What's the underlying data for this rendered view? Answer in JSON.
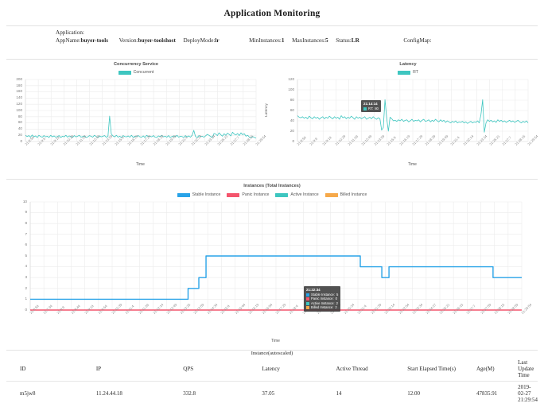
{
  "header": {
    "title": "Application Monitoring"
  },
  "application": {
    "section_label": "Application:",
    "fields": [
      {
        "key": "AppName:",
        "value": "buyer-tools"
      },
      {
        "key": "Version:",
        "value": "buyer-toolshost"
      },
      {
        "key": "DeployMode:",
        "value": "lr"
      },
      {
        "key": "MinInstances:",
        "value": "1"
      },
      {
        "key": "MaxInstances:",
        "value": "5"
      },
      {
        "key": "Status:",
        "value": "LR"
      },
      {
        "key": "ConfigMap:",
        "value": ""
      }
    ],
    "appname_key": "AppName:",
    "appname_value": "buyer-tools",
    "version_key": "Version:",
    "version_value": "buyer-toolshost",
    "deploymode_key": "DeployMode:",
    "deploymode_value": "lr",
    "mininstances_key": "MinInstances:",
    "mininstances_value": "1",
    "maxinstances_key": "MaxInstances:",
    "maxinstances_value": "5",
    "status_key": "Status:",
    "status_value": "LR",
    "configmap_key": "ConfigMap:",
    "configmap_value": ""
  },
  "colors": {
    "teal": "#3ec6c0",
    "blue": "#29a3e8",
    "pink": "#f4556d",
    "orange": "#f6a94a",
    "grid": "#ebebeb",
    "axis": "#d6d6d6",
    "tooltip_bg": "#3a3a3a"
  },
  "chart_data": [
    {
      "id": "concurrency",
      "type": "line",
      "title": "Concurrency Service",
      "xlabel": "Time",
      "ylabel": "Concurrent",
      "ylim": [
        0,
        200
      ],
      "yticks": [
        0,
        20,
        40,
        60,
        80,
        100,
        120,
        140,
        160,
        180,
        200
      ],
      "grid": true,
      "legend_position": "top-center",
      "legend": [
        {
          "name": "Concurrent",
          "color": "#3ec6c0"
        }
      ],
      "xticks": [
        "21:8:59",
        "21:9:9",
        "21:9:19",
        "21:10:29",
        "21:11:39",
        "21:12:49",
        "21:13:59",
        "21:15:9",
        "21:16:19",
        "21:17:29",
        "21:18:39",
        "21:19:49",
        "21:21:4",
        "21:22:14",
        "21:23:34",
        "21:25:21",
        "21:27:7",
        "21:28:15",
        "21:29:54"
      ],
      "series": [
        {
          "name": "Concurrent",
          "color": "#3ec6c0",
          "values": [
            20,
            16,
            19,
            14,
            21,
            15,
            18,
            13,
            20,
            16,
            14,
            19,
            15,
            17,
            13,
            20,
            15,
            18,
            14,
            16,
            19,
            13,
            17,
            15,
            20,
            14,
            18,
            16,
            13,
            19,
            15,
            17,
            20,
            14,
            16,
            18,
            13,
            15,
            19,
            17,
            14,
            20,
            16,
            13,
            18,
            15,
            17,
            19,
            14,
            16,
            82,
            24,
            18,
            15,
            20,
            14,
            17,
            13,
            19,
            16,
            15,
            18,
            14,
            20,
            13,
            17,
            16,
            19,
            15,
            14,
            18,
            13,
            20,
            16,
            17,
            15,
            19,
            14,
            13,
            18,
            16,
            20,
            15,
            17,
            14,
            19,
            13,
            16,
            18,
            15,
            20,
            14,
            17,
            16,
            13,
            19,
            15,
            18,
            14,
            20,
            36,
            16,
            13,
            19,
            15,
            17,
            14,
            18,
            23,
            20,
            16,
            13,
            26,
            24,
            19,
            28,
            22,
            17,
            25,
            20,
            27,
            23,
            18,
            30,
            24,
            21,
            26,
            19,
            28,
            22,
            25,
            17,
            20,
            14,
            12,
            16,
            13,
            11
          ]
        }
      ]
    },
    {
      "id": "latency",
      "type": "line",
      "title": "Latency",
      "xlabel": "Time",
      "ylabel": "Latency",
      "ylim": [
        0,
        120
      ],
      "yticks": [
        0,
        20,
        40,
        60,
        80,
        100,
        120
      ],
      "grid": true,
      "legend_position": "top-center",
      "legend": [
        {
          "name": "RT",
          "color": "#3ec6c0"
        }
      ],
      "xticks": [
        "21:8:59",
        "21:9:9",
        "21:9:19",
        "21:10:29",
        "21:11:39",
        "21:12:49",
        "21:13:59",
        "21:15:9",
        "21:16:19",
        "21:17:29",
        "21:18:39",
        "21:19:49",
        "21:21:4",
        "21:22:14",
        "21:23:34",
        "21:25:21",
        "21:27:7",
        "21:28:15",
        "21:29:54"
      ],
      "series": [
        {
          "name": "RT",
          "color": "#3ec6c0",
          "values": [
            50,
            47,
            46,
            48,
            45,
            47,
            44,
            49,
            46,
            44,
            48,
            45,
            47,
            43,
            46,
            48,
            44,
            47,
            45,
            49,
            46,
            44,
            48,
            45,
            47,
            43,
            50,
            46,
            48,
            44,
            47,
            45,
            49,
            46,
            43,
            48,
            45,
            47,
            44,
            46,
            48,
            43,
            45,
            47,
            44,
            48,
            45,
            43,
            46,
            44,
            22,
            27,
            81,
            45,
            20,
            47,
            44,
            40,
            41,
            39,
            42,
            40,
            43,
            39,
            41,
            42,
            38,
            40,
            43,
            39,
            41,
            40,
            42,
            38,
            41,
            43,
            39,
            40,
            42,
            38,
            41,
            39,
            43,
            40,
            38,
            42,
            39,
            41,
            37,
            40,
            38,
            36,
            39,
            37,
            40,
            36,
            38,
            37,
            39,
            36,
            38,
            35,
            37,
            39,
            36,
            38,
            37,
            40,
            36,
            52,
            81,
            18,
            36,
            42,
            39,
            41,
            38,
            40,
            37,
            42,
            39,
            41,
            38,
            40,
            37,
            39,
            41,
            38,
            40,
            37,
            39,
            41,
            38,
            36,
            39,
            37,
            40,
            36
          ]
        }
      ],
      "tooltip": {
        "time": "21:14:14",
        "rows": [
          {
            "name": "RT:",
            "value": "80",
            "color": "#3ec6c0"
          }
        ]
      }
    },
    {
      "id": "instances",
      "type": "line",
      "title": "Instances (Total Instances)",
      "xlabel": "Time",
      "ylabel": "Instances",
      "ylim": [
        0,
        10
      ],
      "yticks": [
        0,
        1,
        2,
        3,
        4,
        5,
        6,
        7,
        8,
        9,
        10
      ],
      "grid": true,
      "legend_position": "top-center",
      "legend": [
        {
          "name": "Stable Instance",
          "color": "#29a3e8"
        },
        {
          "name": "Panic Instance",
          "color": "#f4556d"
        },
        {
          "name": "Active Instance",
          "color": "#3ec6c0"
        },
        {
          "name": "Billed Instance",
          "color": "#f6a94a"
        }
      ],
      "xticks": [
        "21:6:59",
        "21:7:34",
        "21:8:9",
        "21:8:44",
        "21:9:19",
        "21:9:54",
        "21:10:39",
        "21:11:4",
        "21:11:39",
        "21:12:14",
        "21:12:49",
        "21:13:25",
        "21:13:59",
        "21:14:34",
        "21:15:9",
        "21:15:44",
        "21:16:19",
        "21:16:54",
        "21:17:29",
        "21:18:4",
        "21:18:39",
        "21:19:14",
        "21:19:49",
        "21:20:24",
        "21:21:4",
        "21:21:39",
        "21:22:14",
        "21:22:54",
        "21:23:34",
        "21:24:27",
        "21:25:21",
        "21:26:15",
        "21:27:7",
        "21:27:59",
        "21:28:15",
        "21:28:59",
        "21:29:54"
      ],
      "series": [
        {
          "name": "Stable Instance",
          "color": "#29a3e8",
          "values": [
            1,
            1,
            1,
            1,
            1,
            1,
            1,
            1,
            1,
            1,
            1,
            1,
            1,
            1,
            1,
            1,
            1,
            1,
            1,
            1,
            1,
            1,
            1,
            1,
            1,
            1,
            1,
            1,
            1,
            1,
            1,
            1,
            1,
            1,
            1,
            1,
            1,
            1,
            1,
            1,
            1,
            1,
            1,
            1,
            2,
            2,
            2,
            3,
            3,
            5,
            5,
            5,
            5,
            5,
            5,
            5,
            5,
            5,
            5,
            5,
            5,
            5,
            5,
            5,
            5,
            5,
            5,
            5,
            5,
            5,
            5,
            5,
            5,
            5,
            5,
            5,
            5,
            5,
            5,
            5,
            5,
            5,
            5,
            5,
            5,
            5,
            5,
            5,
            5,
            5,
            5,
            5,
            4,
            4,
            4,
            4,
            4,
            4,
            3,
            3,
            4,
            4,
            4,
            4,
            4,
            4,
            4,
            4,
            4,
            4,
            4,
            4,
            4,
            4,
            4,
            4,
            4,
            4,
            4,
            4,
            4,
            4,
            4,
            4,
            4,
            4,
            4,
            4,
            4,
            3,
            3,
            3,
            3,
            3,
            3,
            3,
            3,
            3
          ]
        },
        {
          "name": "Panic Instance",
          "color": "#f4556d",
          "values": [
            0,
            0,
            0,
            0,
            0,
            0,
            0,
            0,
            0,
            0,
            0,
            0,
            0,
            0,
            0,
            0,
            0,
            0,
            0,
            0,
            0,
            0,
            0,
            0,
            0,
            0,
            0,
            0,
            0,
            0,
            0,
            0,
            0,
            0,
            0,
            0,
            0,
            0,
            0,
            0,
            0,
            0,
            0,
            0,
            0,
            0,
            0,
            0,
            0,
            0,
            0,
            0,
            0,
            0,
            0,
            0,
            0,
            0,
            0,
            0,
            0,
            0,
            0,
            0,
            0,
            0,
            0,
            0,
            0,
            0,
            0,
            0,
            0,
            0,
            0,
            0,
            0,
            0,
            0,
            0,
            0,
            0,
            0,
            0,
            0,
            0,
            0,
            0,
            0,
            0,
            0,
            0,
            0,
            0,
            0,
            0,
            0,
            0,
            0,
            0,
            0,
            0,
            0,
            0,
            0,
            0,
            0,
            0,
            0,
            0,
            0,
            0,
            0,
            0,
            0,
            0,
            0,
            0,
            0,
            0,
            0,
            0,
            0,
            0,
            0,
            0,
            0,
            0,
            0,
            0,
            0,
            0,
            0,
            0,
            0,
            0,
            0,
            0
          ]
        }
      ],
      "tooltip": {
        "time": "21:22:34",
        "rows": [
          {
            "name": "Stable Instance:",
            "value": "5",
            "color": "#29a3e8"
          },
          {
            "name": "Panic Instance:",
            "value": "0",
            "color": "#f4556d"
          },
          {
            "name": "Active Instance:",
            "value": "2",
            "color": "#3ec6c0"
          },
          {
            "name": "Billed Instance:",
            "value": "2",
            "color": "#f6a94a"
          }
        ]
      }
    }
  ],
  "instance_table": {
    "title": "Instance(autoscaled)",
    "columns": [
      "ID",
      "IP",
      "QPS",
      "Latency",
      "Active Thread",
      "Start Elapsed Time(s)",
      "Age(M)",
      "Last Update Time"
    ],
    "rows": [
      {
        "id": "m5jw8",
        "ip": "11.24.44.18",
        "qps": "332.8",
        "latency": "37.05",
        "active_thread": "14",
        "start_elapsed": "12.00",
        "age": "47835.91",
        "last_update": "2019-02-27 21:29:54"
      }
    ]
  }
}
